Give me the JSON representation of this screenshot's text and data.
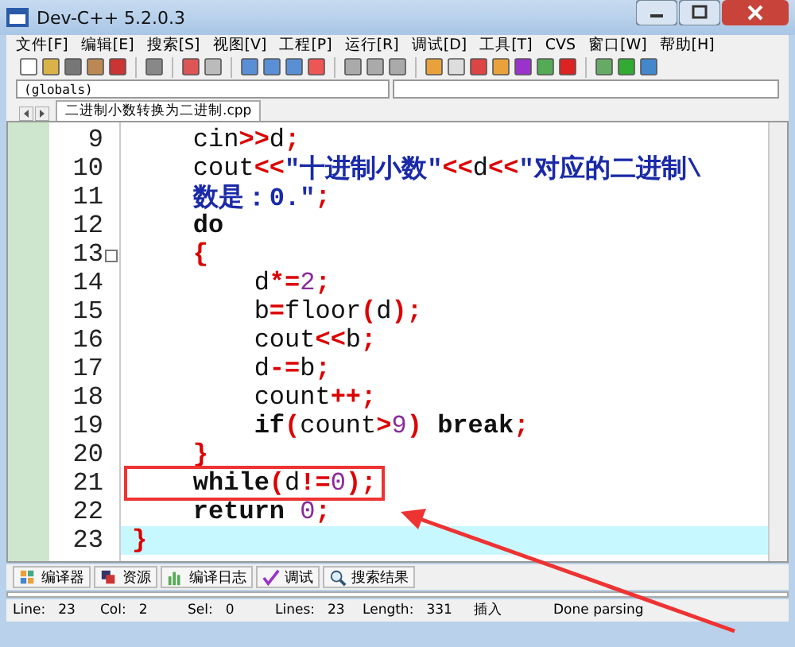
{
  "window": {
    "title": "Dev-C++ 5.2.0.3"
  },
  "menu": [
    "文件[F]",
    "编辑[E]",
    "搜索[S]",
    "视图[V]",
    "工程[P]",
    "运行[R]",
    "调试[D]",
    "工具[T]",
    "CVS",
    "窗口[W]",
    "帮助[H]"
  ],
  "scope_combo": {
    "value": "(globals)"
  },
  "file_tab": {
    "label": "二进制小数转换为二进制.cpp",
    "selected": true
  },
  "code_lines": [
    {
      "number": "9",
      "fold": false,
      "current": false,
      "boxed": false,
      "tokens": [
        {
          "text": "    cin",
          "kind": "plain"
        },
        {
          "text": ">>",
          "kind": "op"
        },
        {
          "text": "d",
          "kind": "plain"
        },
        {
          "text": ";",
          "kind": "op"
        }
      ]
    },
    {
      "number": "10",
      "fold": false,
      "current": false,
      "boxed": false,
      "tokens": [
        {
          "text": "    cout",
          "kind": "plain"
        },
        {
          "text": "<<",
          "kind": "op"
        },
        {
          "text": "\"十进制小数\"",
          "kind": "str"
        },
        {
          "text": "<<",
          "kind": "op"
        },
        {
          "text": "d",
          "kind": "plain"
        },
        {
          "text": "<<",
          "kind": "op"
        },
        {
          "text": "\"对应的二进制\\",
          "kind": "str"
        }
      ]
    },
    {
      "number": "11",
      "fold": false,
      "current": false,
      "boxed": false,
      "tokens": [
        {
          "text": "    数是：0.\"",
          "kind": "str"
        },
        {
          "text": ";",
          "kind": "op"
        }
      ]
    },
    {
      "number": "12",
      "fold": false,
      "current": false,
      "boxed": false,
      "tokens": [
        {
          "text": "    do",
          "kind": "kw"
        }
      ]
    },
    {
      "number": "13",
      "fold": true,
      "current": false,
      "boxed": false,
      "tokens": [
        {
          "text": "    {",
          "kind": "op"
        }
      ]
    },
    {
      "number": "14",
      "fold": false,
      "current": false,
      "boxed": false,
      "tokens": [
        {
          "text": "        d",
          "kind": "plain"
        },
        {
          "text": "*=",
          "kind": "op"
        },
        {
          "text": "2",
          "kind": "num"
        },
        {
          "text": ";",
          "kind": "op"
        }
      ]
    },
    {
      "number": "15",
      "fold": false,
      "current": false,
      "boxed": false,
      "tokens": [
        {
          "text": "        b",
          "kind": "plain"
        },
        {
          "text": "=",
          "kind": "op"
        },
        {
          "text": "floor",
          "kind": "plain"
        },
        {
          "text": "(",
          "kind": "op"
        },
        {
          "text": "d",
          "kind": "plain"
        },
        {
          "text": ")",
          "kind": "op"
        },
        {
          "text": ";",
          "kind": "op"
        }
      ]
    },
    {
      "number": "16",
      "fold": false,
      "current": false,
      "boxed": false,
      "tokens": [
        {
          "text": "        cout",
          "kind": "plain"
        },
        {
          "text": "<<",
          "kind": "op"
        },
        {
          "text": "b",
          "kind": "plain"
        },
        {
          "text": ";",
          "kind": "op"
        }
      ]
    },
    {
      "number": "17",
      "fold": false,
      "current": false,
      "boxed": false,
      "tokens": [
        {
          "text": "        d",
          "kind": "plain"
        },
        {
          "text": "-=",
          "kind": "op"
        },
        {
          "text": "b",
          "kind": "plain"
        },
        {
          "text": ";",
          "kind": "op"
        }
      ]
    },
    {
      "number": "18",
      "fold": false,
      "current": false,
      "boxed": false,
      "tokens": [
        {
          "text": "        count",
          "kind": "plain"
        },
        {
          "text": "++",
          "kind": "op"
        },
        {
          "text": ";",
          "kind": "op"
        }
      ]
    },
    {
      "number": "19",
      "fold": false,
      "current": false,
      "boxed": false,
      "tokens": [
        {
          "text": "        if",
          "kind": "kw"
        },
        {
          "text": "(",
          "kind": "op"
        },
        {
          "text": "count",
          "kind": "plain"
        },
        {
          "text": ">",
          "kind": "op"
        },
        {
          "text": "9",
          "kind": "num"
        },
        {
          "text": ")",
          "kind": "op"
        },
        {
          "text": " break",
          "kind": "kw"
        },
        {
          "text": ";",
          "kind": "op"
        }
      ]
    },
    {
      "number": "20",
      "fold": false,
      "current": false,
      "boxed": false,
      "tokens": [
        {
          "text": "    }",
          "kind": "op"
        }
      ]
    },
    {
      "number": "21",
      "fold": false,
      "current": false,
      "boxed": true,
      "tokens": [
        {
          "text": "    while",
          "kind": "kw"
        },
        {
          "text": "(",
          "kind": "op"
        },
        {
          "text": "d",
          "kind": "plain"
        },
        {
          "text": "!=",
          "kind": "op"
        },
        {
          "text": "0",
          "kind": "num"
        },
        {
          "text": ")",
          "kind": "op"
        },
        {
          "text": ";",
          "kind": "op"
        }
      ]
    },
    {
      "number": "22",
      "fold": false,
      "current": false,
      "boxed": false,
      "tokens": [
        {
          "text": "    return",
          "kind": "kw"
        },
        {
          "text": " 0",
          "kind": "num"
        },
        {
          "text": ";",
          "kind": "op"
        }
      ]
    },
    {
      "number": "23",
      "fold": false,
      "current": true,
      "boxed": false,
      "tokens": [
        {
          "text": "}",
          "kind": "op"
        }
      ]
    }
  ],
  "bottom_tabs": [
    {
      "label": "编译器"
    },
    {
      "label": "资源"
    },
    {
      "label": "编译日志"
    },
    {
      "label": "调试"
    },
    {
      "label": "搜索结果"
    }
  ],
  "status_bar": [
    {
      "label": "Line:",
      "value": "23"
    },
    {
      "label": "Col:",
      "value": "2"
    },
    {
      "label": "Sel:",
      "value": "0"
    },
    {
      "label": "Lines:",
      "value": "23"
    },
    {
      "label": "Length:",
      "value": "331"
    },
    {
      "label": "插入"
    },
    {
      "label": "Done parsing"
    }
  ]
}
